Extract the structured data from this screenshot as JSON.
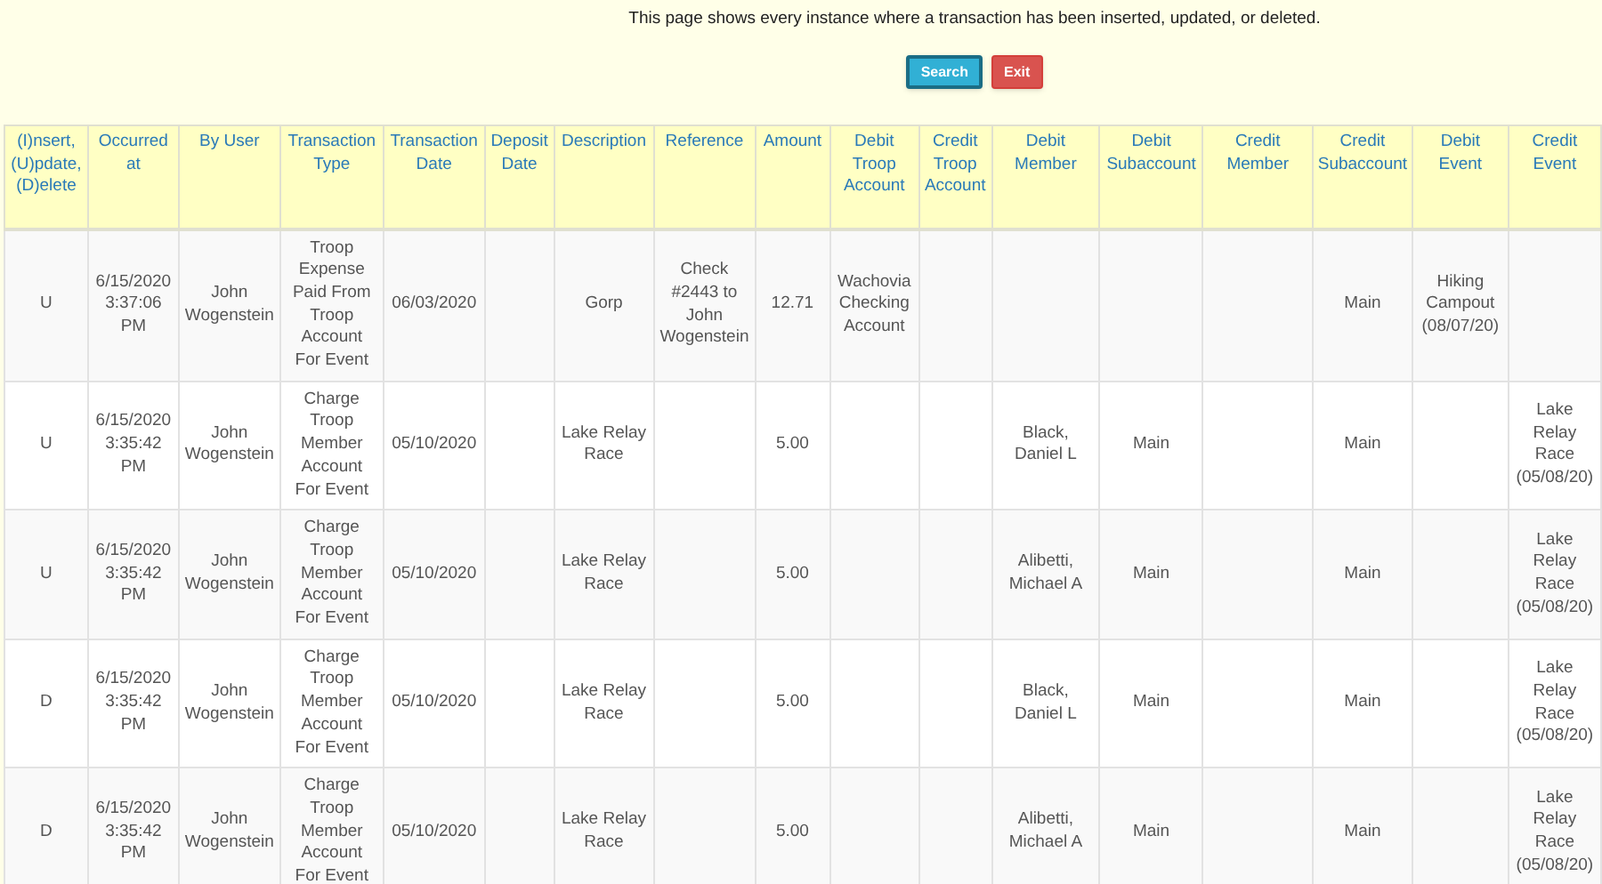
{
  "intro": "This page shows every instance where a transaction has been inserted, updated, or deleted.",
  "buttons": [
    {
      "label": "Search",
      "kind": "search"
    },
    {
      "label": "Exit",
      "kind": "exit"
    }
  ],
  "table": {
    "columns": [
      "(I)nsert, (U)pdate, (D)elete",
      "Occurred at",
      "By User",
      "Transaction Type",
      "Transaction Date",
      "Deposit Date",
      "Description",
      "Reference",
      "Amount",
      "Debit Troop Account",
      "Credit Troop Account",
      "Debit Member",
      "Debit Subaccount",
      "Credit Member",
      "Credit Subaccount",
      "Debit Event",
      "Credit Event"
    ],
    "rows": [
      {
        "cells": [
          "U",
          "6/15/2020 3:37:06 PM",
          "John Wogenstein",
          "Troop Expense Paid From Troop Account For Event",
          "06/03/2020",
          null,
          "Gorp",
          "Check #2443 to John Wogenstein",
          "12.71",
          "Wachovia Checking Account",
          null,
          null,
          null,
          null,
          "Main",
          "Hiking Campout (08/07/20)",
          null
        ]
      },
      {
        "cells": [
          "U",
          "6/15/2020 3:35:42 PM",
          "John Wogenstein",
          "Charge Troop Member Account For Event",
          "05/10/2020",
          null,
          "Lake Relay Race",
          null,
          "5.00",
          null,
          null,
          "Black, Daniel L",
          "Main",
          null,
          "Main",
          null,
          "Lake Relay Race (05/08/20)"
        ]
      },
      {
        "cells": [
          "U",
          "6/15/2020 3:35:42 PM",
          "John Wogenstein",
          "Charge Troop Member Account For Event",
          "05/10/2020",
          null,
          "Lake Relay Race",
          null,
          "5.00",
          null,
          null,
          "Alibetti, Michael A",
          "Main",
          null,
          "Main",
          null,
          "Lake Relay Race (05/08/20)"
        ]
      },
      {
        "cells": [
          "D",
          "6/15/2020 3:35:42 PM",
          "John Wogenstein",
          "Charge Troop Member Account For Event",
          "05/10/2020",
          null,
          "Lake Relay Race",
          null,
          "5.00",
          null,
          null,
          "Black, Daniel L",
          "Main",
          null,
          "Main",
          null,
          "Lake Relay Race (05/08/20)"
        ]
      },
      {
        "cells": [
          "D",
          "6/15/2020 3:35:42 PM",
          "John Wogenstein",
          "Charge Troop Member Account For Event",
          "05/10/2020",
          null,
          "Lake Relay Race",
          null,
          "5.00",
          null,
          null,
          "Alibetti, Michael A",
          "Main",
          null,
          "Main",
          null,
          "Lake Relay Race (05/08/20)"
        ]
      }
    ]
  }
}
